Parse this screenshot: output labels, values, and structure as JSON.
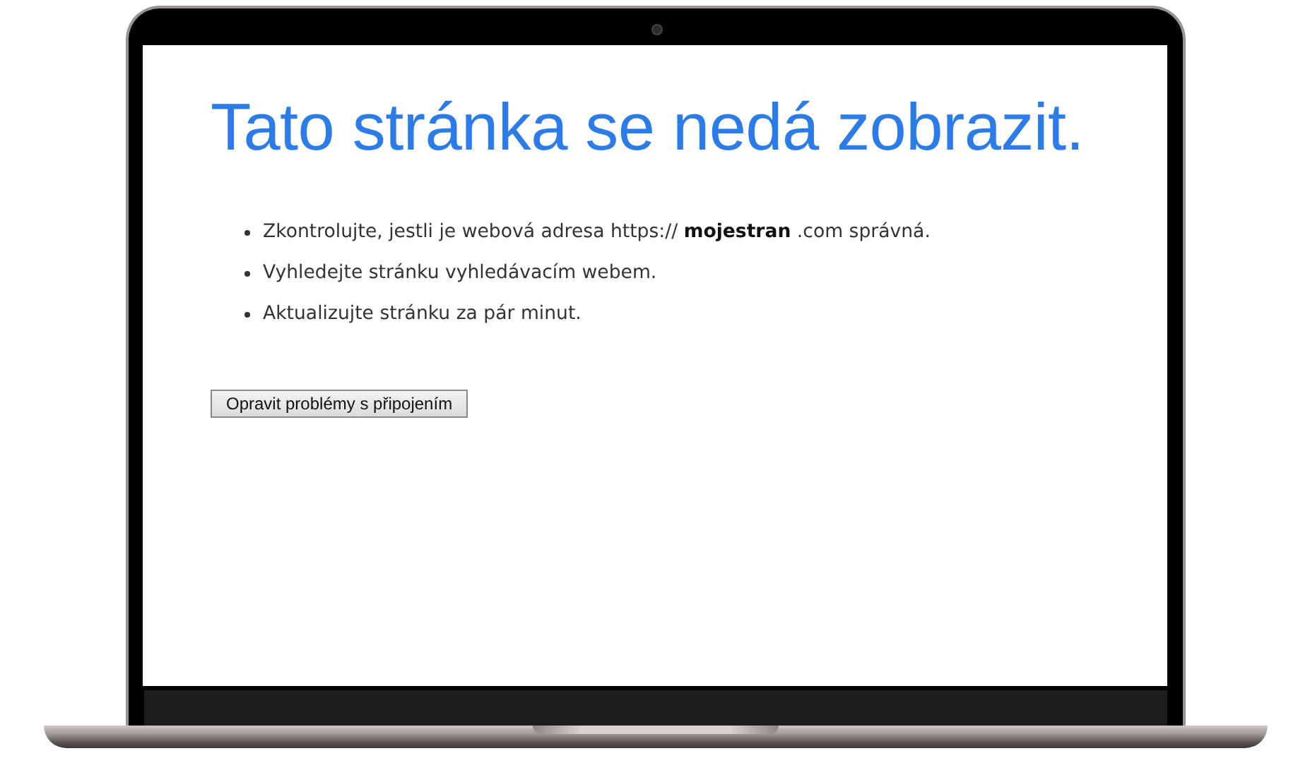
{
  "title": "Tato stránka se nedá zobrazit.",
  "suggestions": [
    "Zkontrolujte, jestli je webová adresa https:// **mojestran** .com správná.",
    "Vyhledejte stránku vyhledávacím webem.",
    "Aktualizujte stránku za pár minut."
  ],
  "button": {
    "label": "Opravit problémy s připojením"
  }
}
